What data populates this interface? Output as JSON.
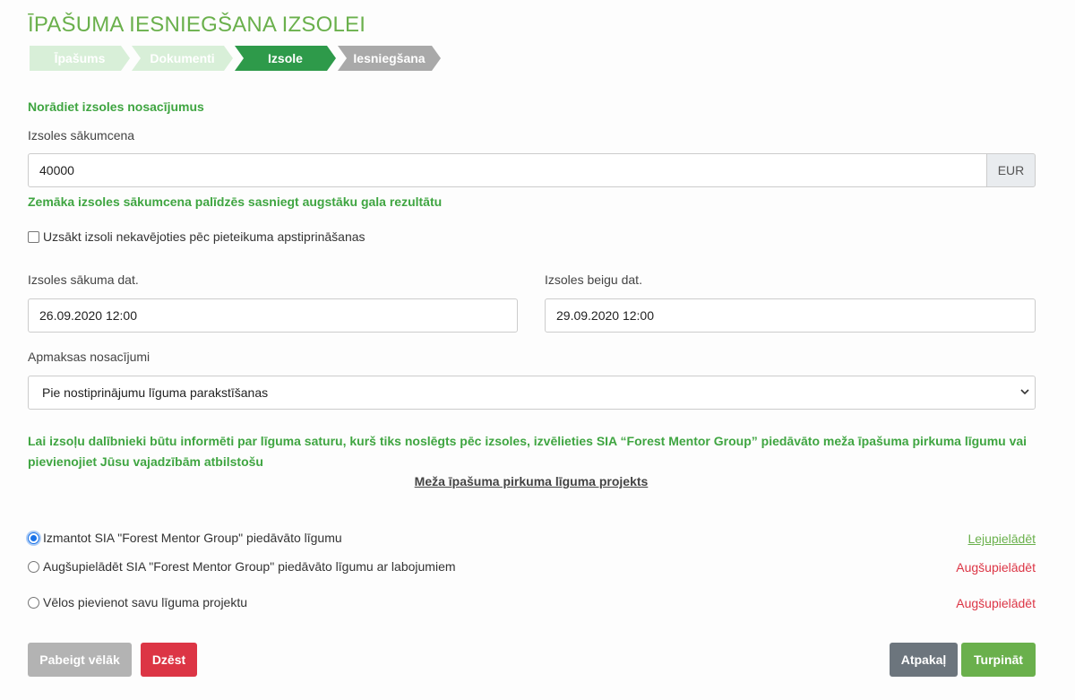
{
  "page": {
    "title": "ĪPAŠUMA IESNIEGŠANA IZSOLEI"
  },
  "steps": [
    {
      "label": "Īpašums",
      "state": "done"
    },
    {
      "label": "Dokumenti",
      "state": "done"
    },
    {
      "label": "Izsole",
      "state": "active"
    },
    {
      "label": "Iesniegšana",
      "state": "todo"
    }
  ],
  "form": {
    "heading": "Norādiet izsoles nosacījumus",
    "start_price_label": "Izsoles sākumcena",
    "start_price_value": "40000",
    "currency": "EUR",
    "price_hint": "Zemāka izsoles sākumcena palīdzēs sasniegt augstāku gala rezultātu",
    "immediate_start_label": "Uzsākt izsoli nekavējoties pēc pieteikuma apstiprināšanas",
    "immediate_start_checked": false,
    "start_date_label": "Izsoles sākuma dat.",
    "start_date_value": "26.09.2020 12:00",
    "end_date_label": "Izsoles beigu dat.",
    "end_date_value": "29.09.2020 12:00",
    "payment_label": "Apmaksas nosacījumi",
    "payment_value": "Pie nostiprinājumu līguma parakstīšanas"
  },
  "contract": {
    "info_text": "Lai izsoļu dalībnieki būtu informēti par līguma saturu, kurš tiks noslēgts pēc izsoles, izvēlieties SIA “Forest Mentor Group” piedāvāto meža īpašuma pirkuma līgumu vai pievienojiet Jūsu vajadzībām atbilstošu",
    "draft_link": "Meža īpašuma pirkuma līguma projekts",
    "options": [
      {
        "label": "Izmantot SIA \"Forest Mentor Group\" piedāvāto līgumu",
        "action": "Lejupielādēt",
        "checked": true
      },
      {
        "label": "Augšupielādēt SIA \"Forest Mentor Group\" piedāvāto līgumu ar labojumiem",
        "action": "Augšupielādēt",
        "checked": false
      },
      {
        "label": "Vēlos pievienot savu līguma projektu",
        "action": "Augšupielādēt",
        "checked": false
      }
    ]
  },
  "buttons": {
    "finish_later": "Pabeigt vēlāk",
    "delete": "Dzēst",
    "back": "Atpakaļ",
    "continue": "Turpināt"
  },
  "colors": {
    "brand_green": "#6ab04c",
    "active_step": "#2e9a4a",
    "danger": "#dc3545",
    "secondary": "#6c757d"
  }
}
